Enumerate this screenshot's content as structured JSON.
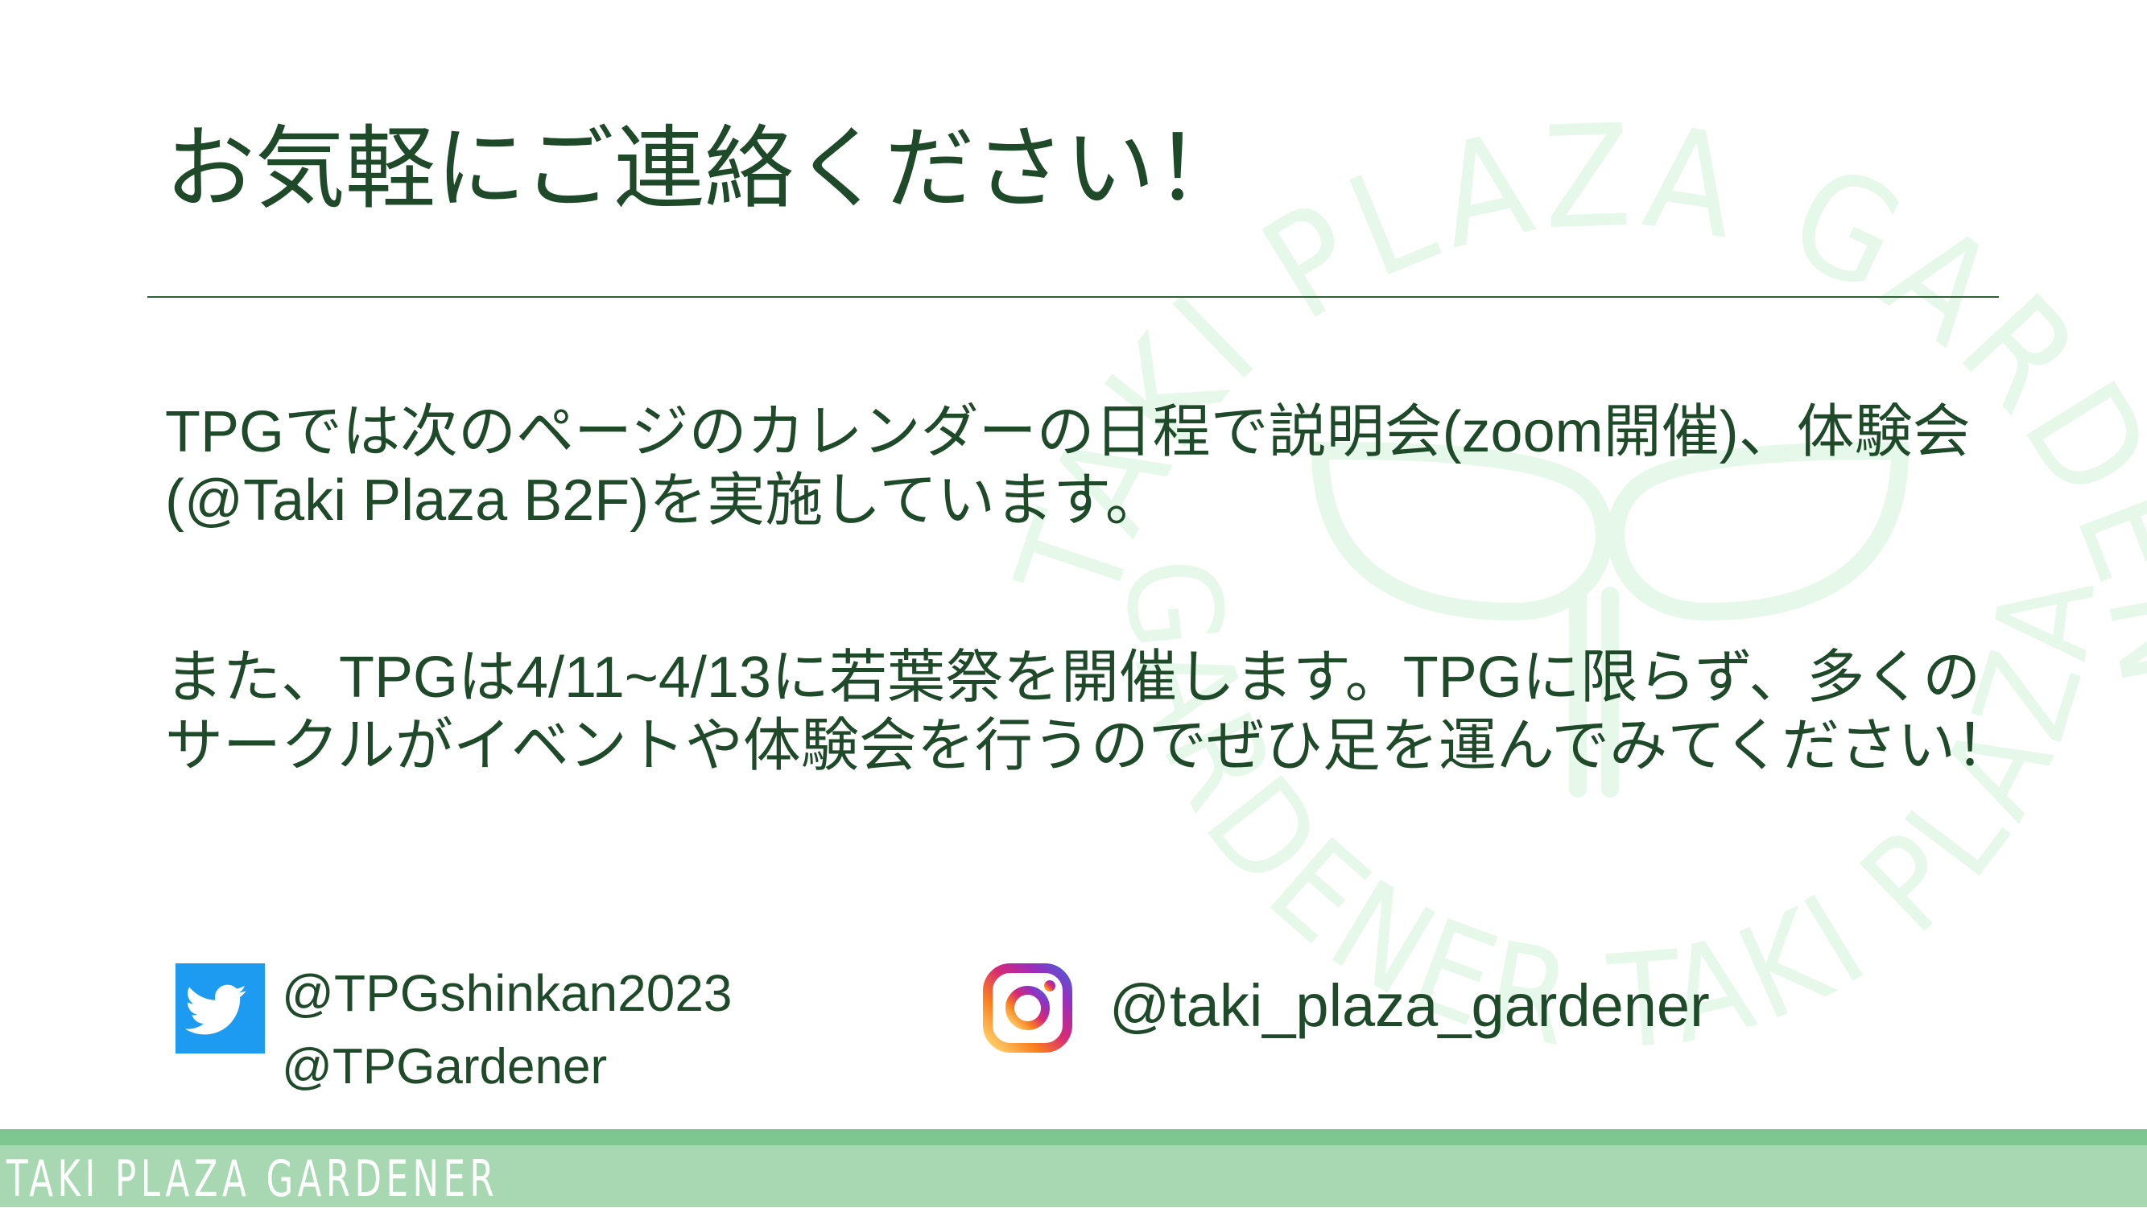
{
  "title": "お気軽にご連絡ください！",
  "paragraphs": [
    "TPGでは次のページのカレンダーの日程で説明会(zoom開催)、体験会(@Taki Plaza B2F)を実施しています。",
    "また、TPGは4/11~4/13に若葉祭を開催します。TPGに限らず、多くのサークルがイベントや体験会を行うのでぜひ足を運んでみてください！"
  ],
  "twitter": {
    "icon": "twitter-bird-icon",
    "color": "#1d9bf0",
    "handles": [
      "@TPGshinkan2023",
      "@TPGardener"
    ]
  },
  "instagram": {
    "icon": "instagram-icon",
    "handle": "@taki_plaza_gardener"
  },
  "footer": {
    "label": "TAKI PLAZA GARDENER"
  },
  "colors": {
    "text": "#1f4a2a",
    "accent_green": "#a7d8b1",
    "watermark": "#e6f8ea"
  }
}
